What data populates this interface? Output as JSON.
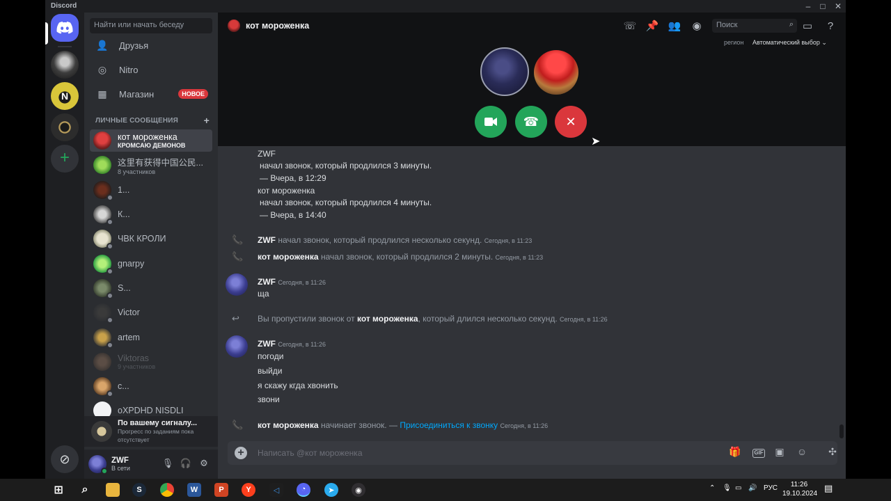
{
  "window": {
    "brand": "Discord"
  },
  "dm_sidebar": {
    "search_placeholder": "Найти или начать беседу",
    "nav": {
      "friends": "Друзья",
      "nitro": "Nitro",
      "shop": "Магазин",
      "shop_badge": "НОВОЕ"
    },
    "section_title": "ЛИЧНЫЕ СООБЩЕНИЯ",
    "conversations": [
      {
        "name": "кот мороженка",
        "sub": "КРОМСАЮ ДЕМОНОВ"
      },
      {
        "name": "这里有获得中国公民...",
        "sub": "8 участников"
      },
      {
        "name": "1...",
        "sub": ""
      },
      {
        "name": "К...",
        "sub": ""
      },
      {
        "name": "ЧВК КРОЛИ",
        "sub": ""
      },
      {
        "name": "gnarpy",
        "sub": ""
      },
      {
        "name": "S...",
        "sub": ""
      },
      {
        "name": "Victor",
        "sub": ""
      },
      {
        "name": "artem",
        "sub": ""
      },
      {
        "name": "Viktoras",
        "sub": "9 участников"
      },
      {
        "name": "c...",
        "sub": ""
      },
      {
        "name": "oXPDHD NISDLI",
        "sub": ""
      }
    ],
    "quest": {
      "title": "По вашему сигналу...",
      "line1": "Прогресс по заданиям пока",
      "line2": "отсутствует"
    },
    "user": {
      "name": "ZWF",
      "status": "В сети"
    }
  },
  "header": {
    "channel_name": "кот мороженка",
    "search_placeholder": "Поиск",
    "region_label": "регион",
    "region_value": "Автоматический выбор"
  },
  "messages": {
    "block1": {
      "author1": "ZWF",
      "text1": "начал звонок, который продлился 3 минуты.",
      "time1": "— Вчера, в 12:29",
      "author2": "кот мороженка",
      "text2": "начал звонок, который продлился 4 минуты.",
      "time2": "— Вчера, в 14:40"
    },
    "sys1": {
      "author": "ZWF",
      "text": "начал звонок, который продлился несколько секунд.",
      "time": "Сегодня, в 11:23"
    },
    "sys2": {
      "author": "кот мороженка",
      "text": "начал звонок, который продлился 2 минуты.",
      "time": "Сегодня, в 11:23"
    },
    "msg1": {
      "author": "ZWF",
      "time": "Сегодня, в 11:26",
      "lines": [
        "ща"
      ]
    },
    "missed": {
      "prefix": "Вы пропустили звонок от",
      "author": "кот мороженка",
      "suffix": ", который длился несколько секунд.",
      "time": "Сегодня, в 11:26"
    },
    "msg2": {
      "author": "ZWF",
      "time": "Сегодня, в 11:26",
      "lines": [
        "погоди",
        "выйди",
        "я скажу кгда хвонить",
        "звони"
      ]
    },
    "sys3": {
      "author": "кот мороженка",
      "text": "начинает звонок. —",
      "link": "Присоединиться к звонку",
      "time": "Сегодня, в 11:26"
    }
  },
  "composer": {
    "placeholder": "Написать @кот мороженка",
    "gif_label": "GIF"
  },
  "taskbar": {
    "language": "РУС",
    "time": "11:26",
    "date": "19.10.2024",
    "icons": [
      "windows-start-icon",
      "search-icon",
      "file-explorer-icon",
      "steam-icon",
      "chrome-icon",
      "word-icon",
      "powerpoint-icon",
      "yandex-icon",
      "visual-studio-icon",
      "discord-icon",
      "telegram-icon",
      "obs-icon"
    ]
  },
  "colors": {
    "accent": "#5865f2",
    "green": "#23a55a",
    "red": "#da373c",
    "link": "#00a8fc"
  }
}
